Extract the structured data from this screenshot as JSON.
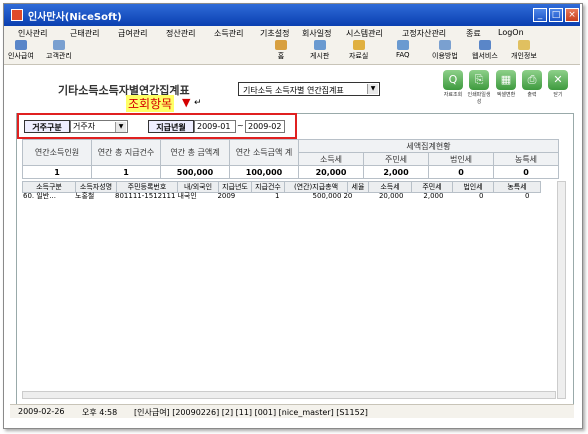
{
  "window": {
    "title": "인사만사(NiceSoft)",
    "buttons": [
      "_",
      "□",
      "×"
    ]
  },
  "menu": [
    "인사관리",
    "근태관리",
    "급여관리",
    "정산관리",
    "소득관리",
    "기초설정",
    "회사일정",
    "시스템관리",
    "고정자산관리",
    "종료",
    "LogOn"
  ],
  "toolbar": [
    {
      "label": "인사급여",
      "icon": "payroll-icon"
    },
    {
      "label": "고객관리",
      "icon": "customer-icon"
    },
    {
      "label": "홈",
      "icon": "home-icon"
    },
    {
      "label": "게시판",
      "icon": "board-icon"
    },
    {
      "label": "자료실",
      "icon": "archive-icon"
    },
    {
      "label": "FAQ",
      "icon": "faq-icon"
    },
    {
      "label": "이용방법",
      "icon": "help-icon"
    },
    {
      "label": "웹서비스",
      "icon": "web-icon"
    },
    {
      "label": "개인정보",
      "icon": "person-icon"
    }
  ],
  "form": {
    "title": "기타소득소득자별연간집계표",
    "report_select": "기타소득 소득자별 연간집계표",
    "actions": [
      {
        "label": "자료조회",
        "icon": "search-icon",
        "glyph": "Q"
      },
      {
        "label": "인쇄파일생성",
        "icon": "file-icon",
        "glyph": "⎘"
      },
      {
        "label": "엑셀변환",
        "icon": "excel-icon",
        "glyph": "▦"
      },
      {
        "label": "출력",
        "icon": "print-icon",
        "glyph": "⎙"
      },
      {
        "label": "닫기",
        "icon": "close-icon",
        "glyph": "✕"
      }
    ]
  },
  "annotation": {
    "text": "조회항목",
    "arrow": "▼",
    "mark": "↵"
  },
  "filters": {
    "residence_label": "거주구분",
    "residence_value": "거주자",
    "period_label": "지급년월",
    "from": "2009-01",
    "tilde": "~",
    "to": "2009-02"
  },
  "summary": {
    "headers": [
      "연간소득인원",
      "연간 총 지급건수",
      "연간 총 금액계",
      "연간 소득금액 계",
      "세액집계현황"
    ],
    "tax_headers": [
      "소득세",
      "주민세",
      "법인세",
      "농특세"
    ],
    "values": [
      "1",
      "1",
      "500,000",
      "100,000",
      "20,000",
      "2,000",
      "0",
      "0"
    ]
  },
  "grid": {
    "headers": [
      "소득구분",
      "소득자성명",
      "주민등록번호",
      "내/외국인",
      "지급년도",
      "지급건수",
      "(연간)지급총액",
      "세율",
      "소득세",
      "주민세",
      "법인세",
      "농특세"
    ],
    "rows": [
      [
        "60. 일반...",
        "노홍철",
        "801111-1512111",
        "내국인",
        "2009",
        "1",
        "500,000",
        "20",
        "20,000",
        "2,000",
        "0",
        "0"
      ]
    ]
  },
  "status": [
    "2009-02-26",
    "오후 4:58",
    "[인사급여] [20090226] [2] [11] [001] [nice_master] [S1152]"
  ]
}
